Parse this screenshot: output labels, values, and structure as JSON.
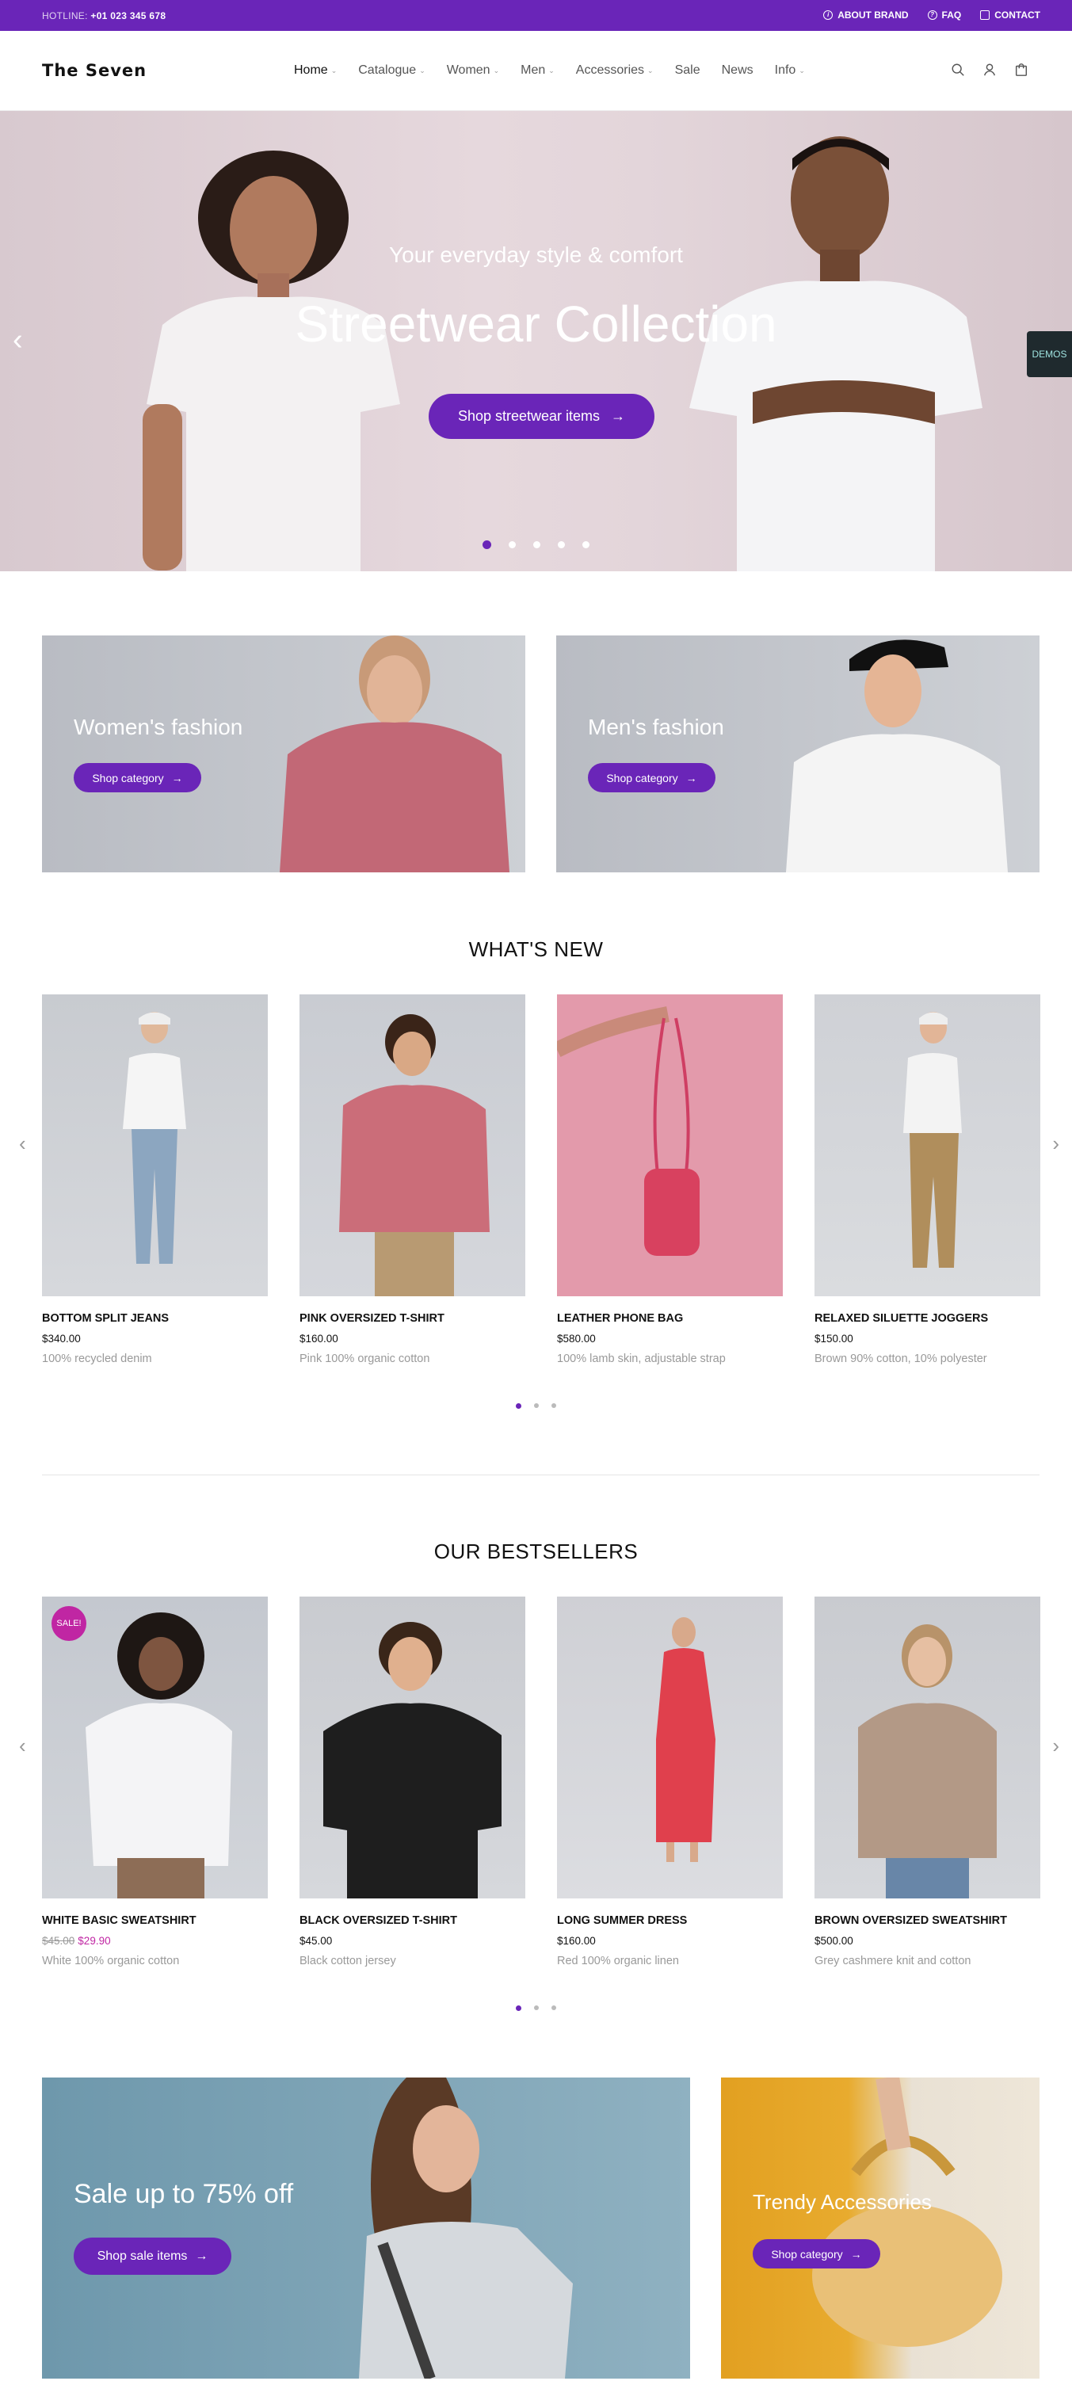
{
  "topbar": {
    "hotline_label": "HOTLINE:",
    "hotline_number": "+01 023 345 678",
    "links": [
      {
        "icon": "info-icon",
        "label": "ABOUT BRAND"
      },
      {
        "icon": "help-icon",
        "label": "FAQ"
      },
      {
        "icon": "mail-icon",
        "label": "CONTACT"
      }
    ]
  },
  "header": {
    "logo": "The Seven",
    "nav": [
      {
        "label": "Home",
        "dropdown": true
      },
      {
        "label": "Catalogue",
        "dropdown": true
      },
      {
        "label": "Women",
        "dropdown": true
      },
      {
        "label": "Men",
        "dropdown": true
      },
      {
        "label": "Accessories",
        "dropdown": true
      },
      {
        "label": "Sale",
        "dropdown": false
      },
      {
        "label": "News",
        "dropdown": false
      },
      {
        "label": "Info",
        "dropdown": true
      }
    ],
    "icons": [
      "search-icon",
      "user-icon",
      "bag-icon"
    ]
  },
  "hero": {
    "subtitle": "Your everyday style & comfort",
    "title": "Streetwear Collection",
    "button": "Shop streetwear items",
    "slides": 5,
    "active_slide": 1,
    "demos_label": "DEMOS"
  },
  "categories": [
    {
      "title": "Women's fashion",
      "button": "Shop category"
    },
    {
      "title": "Men's fashion",
      "button": "Shop category"
    }
  ],
  "whats_new": {
    "title": "WHAT'S NEW",
    "products": [
      {
        "name": "BOTTOM SPLIT JEANS",
        "price": "$340.00",
        "desc": "100% recycled denim"
      },
      {
        "name": "PINK OVERSIZED T-SHIRT",
        "price": "$160.00",
        "desc": "Pink 100% organic cotton"
      },
      {
        "name": "LEATHER PHONE BAG",
        "price": "$580.00",
        "desc": "100% lamb skin, adjustable strap"
      },
      {
        "name": "RELAXED SILUETTE JOGGERS",
        "price": "$150.00",
        "desc": "Brown 90% cotton, 10% polyester"
      }
    ]
  },
  "bestsellers": {
    "title": "OUR BESTSELLERS",
    "products": [
      {
        "name": "WHITE BASIC SWEATSHIRT",
        "old_price": "$45.00",
        "price": "$29.90",
        "desc": "White 100% organic cotton",
        "badge": "SALE!"
      },
      {
        "name": "BLACK OVERSIZED T-SHIRT",
        "price": "$45.00",
        "desc": "Black cotton jersey"
      },
      {
        "name": "LONG SUMMER DRESS",
        "price": "$160.00",
        "desc": "Red 100% organic linen"
      },
      {
        "name": "BROWN OVERSIZED SWEATSHIRT",
        "price": "$500.00",
        "desc": "Grey cashmere knit and cotton"
      }
    ]
  },
  "promos": [
    {
      "title": "Sale up to 75% off",
      "button": "Shop sale items"
    },
    {
      "title": "Trendy Accessories",
      "button": "Shop category"
    }
  ],
  "colors": {
    "accent": "#6a25b8",
    "sale": "#c026a3"
  }
}
